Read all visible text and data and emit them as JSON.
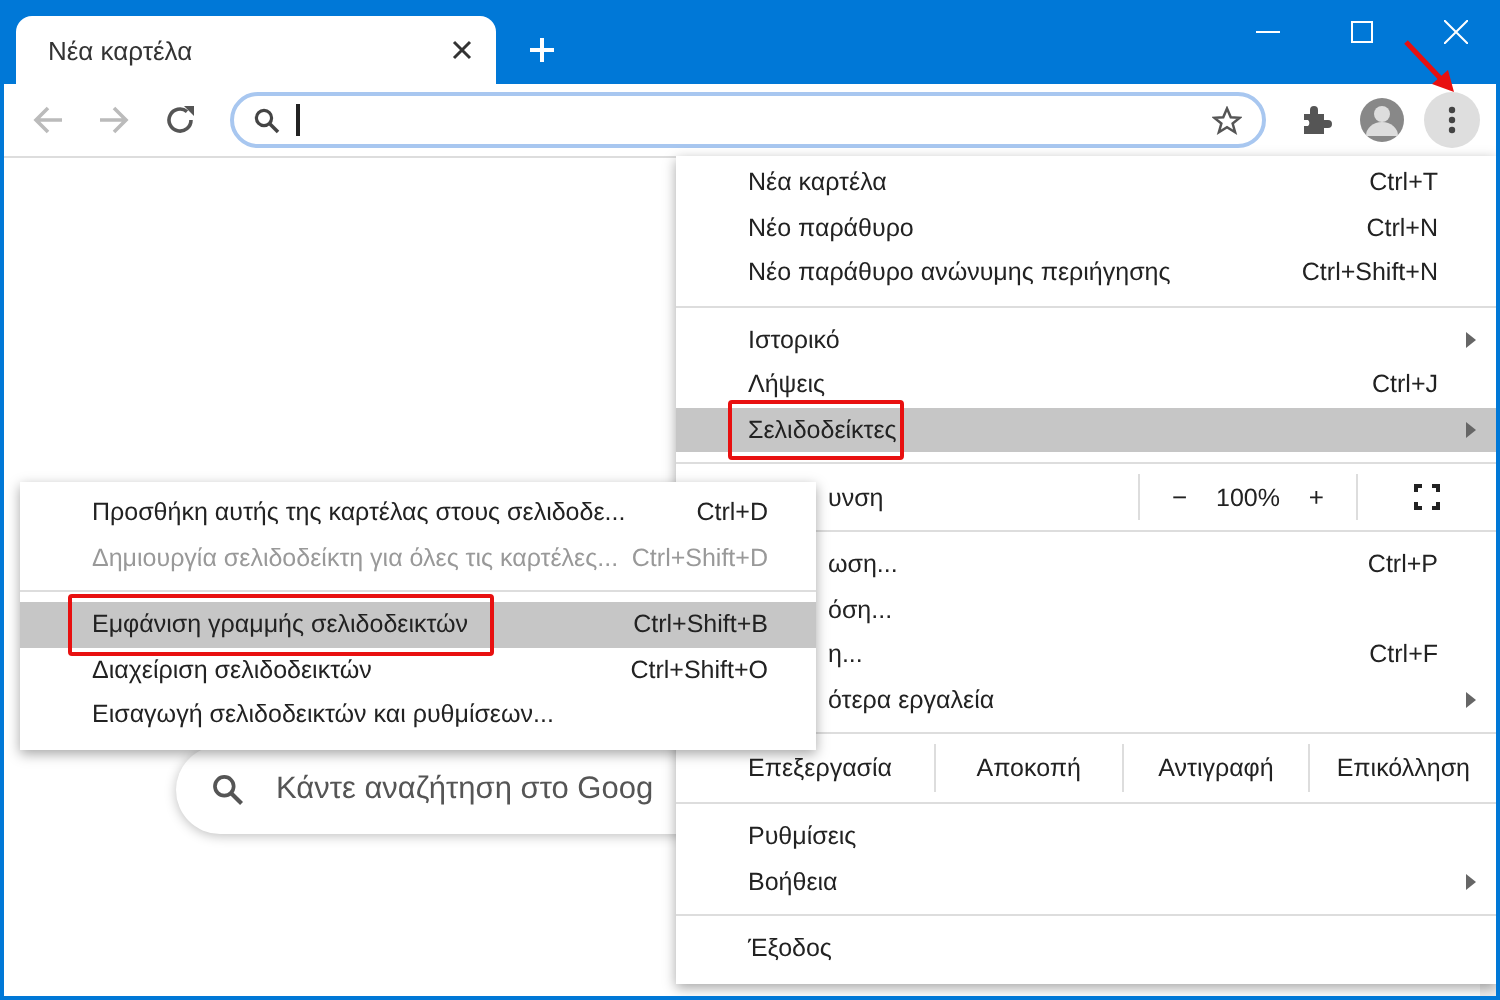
{
  "tabs": [
    {
      "label": "Νέα καρτέλα",
      "selected": true
    }
  ],
  "toolbar": {
    "back_disabled": true,
    "forward_disabled": true
  },
  "page": {
    "search": {
      "placeholder": "Κάντε αναζήτηση στο Goog"
    }
  },
  "annotations": {
    "menu_arrow": true
  },
  "menu": {
    "sections": [
      [
        {
          "kind": "item",
          "label": "Νέα καρτέλα",
          "shortcut": "Ctrl+T",
          "selected": false
        },
        {
          "kind": "item",
          "label": "Νέο παράθυρο",
          "shortcut": "Ctrl+N",
          "selected": false
        },
        {
          "kind": "item",
          "label": "Νέο παράθυρο ανώνυμης περιήγησης",
          "shortcut": "Ctrl+Shift+N",
          "selected": false
        }
      ],
      [
        {
          "kind": "item",
          "label": "Ιστορικό",
          "submenu": true,
          "selected": false
        },
        {
          "kind": "item",
          "label": "Λήψεις",
          "shortcut": "Ctrl+J",
          "selected": false
        },
        {
          "kind": "item",
          "label": "Σελιδοδείκτες",
          "submenu": true,
          "selected": true,
          "annotated": true
        }
      ],
      [
        {
          "kind": "zoom",
          "label": "υνση",
          "covered": true,
          "minus": "−",
          "value": "100%",
          "plus": "+"
        }
      ],
      [
        {
          "kind": "item",
          "label": "ωση...",
          "shortcut": "Ctrl+P",
          "covered": true,
          "selected": false
        },
        {
          "kind": "item",
          "label": "όση...",
          "covered": true,
          "selected": false
        },
        {
          "kind": "item",
          "label": "η...",
          "shortcut": "Ctrl+F",
          "covered": true,
          "selected": false
        },
        {
          "kind": "item",
          "label": "ότερα εργαλεία",
          "submenu": true,
          "covered": true,
          "selected": false
        }
      ],
      [
        {
          "kind": "edit",
          "label": "Επεξεργασία",
          "buttons": [
            "Αποκοπή",
            "Αντιγραφή",
            "Επικόλληση"
          ]
        }
      ],
      [
        {
          "kind": "item",
          "label": "Ρυθμίσεις",
          "selected": false
        },
        {
          "kind": "item",
          "label": "Βοήθεια",
          "submenu": true,
          "selected": false
        }
      ],
      [
        {
          "kind": "item",
          "label": "Έξοδος",
          "selected": false
        }
      ]
    ]
  },
  "submenu": {
    "sections": [
      [
        {
          "label": "Προσθήκη αυτής της καρτέλας στους σελιδοδε...",
          "shortcut": "Ctrl+D",
          "disabled": false,
          "selected": false,
          "annotated": false
        },
        {
          "label": "Δημιουργία σελιδοδείκτη για όλες τις καρτέλες...",
          "shortcut": "Ctrl+Shift+D",
          "disabled": true,
          "selected": false,
          "annotated": false
        }
      ],
      [
        {
          "label": "Εμφάνιση γραμμής σελιδοδεικτών",
          "shortcut": "Ctrl+Shift+B",
          "disabled": false,
          "selected": true,
          "annotated": true
        },
        {
          "label": "Διαχείριση σελιδοδεικτών",
          "shortcut": "Ctrl+Shift+O",
          "disabled": false,
          "selected": false,
          "annotated": false
        },
        {
          "label": "Εισαγωγή σελιδοδεικτών και ρυθμίσεων...",
          "disabled": false,
          "selected": false,
          "annotated": false
        }
      ]
    ]
  }
}
